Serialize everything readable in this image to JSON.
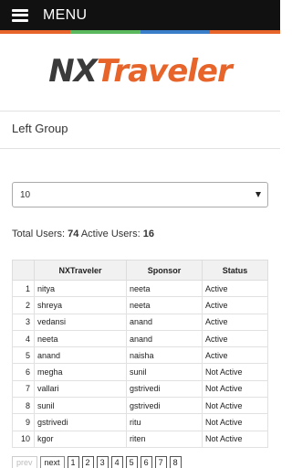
{
  "header": {
    "menu_label": "MENU"
  },
  "stripe_colors": [
    "#e7642a",
    "#5cb85c",
    "#3a7dc9",
    "#e7642a"
  ],
  "logo": {
    "part1": "NX",
    "part2": "Traveler"
  },
  "group": {
    "title": "Left Group"
  },
  "page_size": {
    "selected": "10"
  },
  "summary": {
    "total_label": "Total Users:",
    "total": "74",
    "active_label": "Active Users:",
    "active": "16"
  },
  "table": {
    "headers": [
      "",
      "NXTraveler",
      "Sponsor",
      "Status"
    ],
    "rows": [
      [
        "1",
        "nitya",
        "neeta",
        "Active"
      ],
      [
        "2",
        "shreya",
        "neeta",
        "Active"
      ],
      [
        "3",
        "vedansi",
        "anand",
        "Active"
      ],
      [
        "4",
        "neeta",
        "anand",
        "Active"
      ],
      [
        "5",
        "anand",
        "naisha",
        "Active"
      ],
      [
        "6",
        "megha",
        "sunil",
        "Not Active"
      ],
      [
        "7",
        "vallari",
        "gstrivedi",
        "Not Active"
      ],
      [
        "8",
        "sunil",
        "gstrivedi",
        "Not Active"
      ],
      [
        "9",
        "gstrivedi",
        "ritu",
        "Not Active"
      ],
      [
        "10",
        "kgor",
        "riten",
        "Not Active"
      ]
    ]
  },
  "pagination": {
    "prev": "prev",
    "next": "next",
    "pages": [
      "1",
      "2",
      "3",
      "4",
      "5",
      "6",
      "7",
      "8"
    ]
  }
}
